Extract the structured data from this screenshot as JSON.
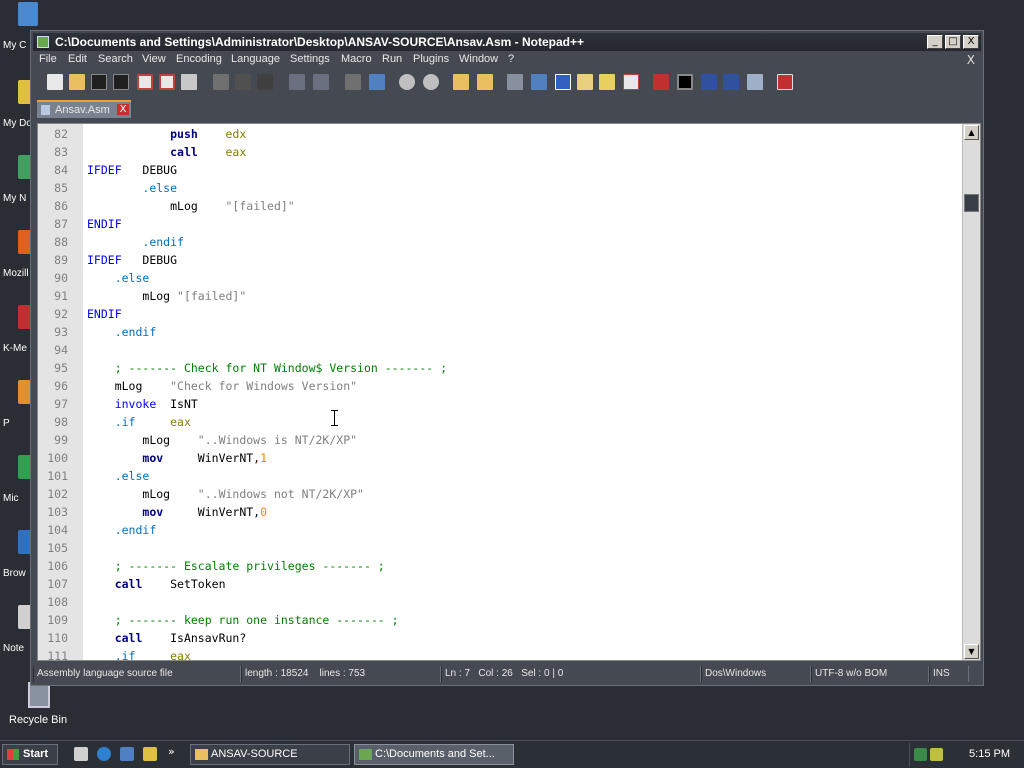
{
  "desktop": {
    "icons": [
      {
        "label": "My C",
        "color": "#4a8ad0"
      },
      {
        "label": "My Do",
        "color": "#e0c040"
      },
      {
        "label": "My N",
        "color": "#40a060"
      },
      {
        "label": "Mozill",
        "color": "#e06020"
      },
      {
        "label": "K-Me",
        "color": "#c03030"
      },
      {
        "label": "P",
        "color": "#e09030"
      },
      {
        "label": "Mic",
        "color": "#30a050"
      },
      {
        "label": "Brow",
        "color": "#3070c0"
      },
      {
        "label": "Note",
        "color": "#d0d0d0"
      }
    ],
    "recycle_bin": "Recycle Bin"
  },
  "window": {
    "title": "C:\\Documents and Settings\\Administrator\\Desktop\\ANSAV-SOURCE\\Ansav.Asm - Notepad++",
    "buttons": {
      "minimize": "_",
      "maximize": "□",
      "close": "X"
    },
    "menu": [
      "File",
      "Edit",
      "Search",
      "View",
      "Encoding",
      "Language",
      "Settings",
      "Macro",
      "Run",
      "Plugins",
      "Window",
      "?"
    ],
    "menu_close": "X",
    "toolbar_icons": [
      "new-file",
      "open-file",
      "save",
      "save-all",
      "close",
      "close-all",
      "print",
      "cut",
      "copy",
      "paste",
      "undo",
      "redo",
      "find",
      "replace",
      "zoom-in",
      "zoom-out",
      "sync-v",
      "sync-h",
      "wrap",
      "all-chars",
      "indent-guide",
      "user-lang",
      "doc-map",
      "function-list",
      "record-macro",
      "stop-record",
      "play-macro",
      "run-macro-multiple",
      "save-macro",
      "spellcheck"
    ],
    "tab": {
      "label": "Ansav.Asm",
      "close": "X"
    }
  },
  "editor": {
    "lines": [
      {
        "n": "82",
        "tokens": [
          [
            "",
            "            "
          ],
          [
            "kw-bold",
            "push"
          ],
          [
            "",
            "    "
          ],
          [
            "reg",
            "edx"
          ]
        ]
      },
      {
        "n": "83",
        "tokens": [
          [
            "",
            "            "
          ],
          [
            "kw-bold",
            "call"
          ],
          [
            "",
            "    "
          ],
          [
            "reg",
            "eax"
          ]
        ]
      },
      {
        "n": "84",
        "tokens": [
          [
            "kw",
            "IFDEF"
          ],
          [
            "",
            "   "
          ],
          [
            "plain",
            "DEBUG"
          ]
        ]
      },
      {
        "n": "85",
        "tokens": [
          [
            "",
            "        "
          ],
          [
            "dir",
            ".else"
          ]
        ]
      },
      {
        "n": "86",
        "tokens": [
          [
            "",
            "            "
          ],
          [
            "plain",
            "mLog"
          ],
          [
            "",
            "    "
          ],
          [
            "str",
            "\"[failed]\""
          ]
        ]
      },
      {
        "n": "87",
        "tokens": [
          [
            "kw",
            "ENDIF"
          ]
        ]
      },
      {
        "n": "88",
        "tokens": [
          [
            "",
            "        "
          ],
          [
            "dir",
            ".endif"
          ]
        ]
      },
      {
        "n": "89",
        "tokens": [
          [
            "kw",
            "IFDEF"
          ],
          [
            "",
            "   "
          ],
          [
            "plain",
            "DEBUG"
          ]
        ]
      },
      {
        "n": "90",
        "tokens": [
          [
            "",
            "    "
          ],
          [
            "dir",
            ".else"
          ]
        ]
      },
      {
        "n": "91",
        "tokens": [
          [
            "",
            "        "
          ],
          [
            "plain",
            "mLog "
          ],
          [
            "str",
            "\"[failed]\""
          ]
        ]
      },
      {
        "n": "92",
        "tokens": [
          [
            "kw",
            "ENDIF"
          ]
        ]
      },
      {
        "n": "93",
        "tokens": [
          [
            "",
            "    "
          ],
          [
            "dir",
            ".endif"
          ]
        ]
      },
      {
        "n": "94",
        "tokens": []
      },
      {
        "n": "95",
        "tokens": [
          [
            "",
            "    "
          ],
          [
            "cmt",
            "; ------- Check for NT Window$ Version ------- ;"
          ]
        ]
      },
      {
        "n": "96",
        "tokens": [
          [
            "",
            "    "
          ],
          [
            "plain",
            "mLog"
          ],
          [
            "",
            "    "
          ],
          [
            "str",
            "\"Check for Windows Version\""
          ]
        ]
      },
      {
        "n": "97",
        "tokens": [
          [
            "",
            "    "
          ],
          [
            "kw",
            "invoke"
          ],
          [
            "",
            "  "
          ],
          [
            "plain",
            "IsNT"
          ]
        ]
      },
      {
        "n": "98",
        "tokens": [
          [
            "",
            "    "
          ],
          [
            "dir",
            ".if"
          ],
          [
            "",
            "     "
          ],
          [
            "reg",
            "eax"
          ]
        ]
      },
      {
        "n": "99",
        "tokens": [
          [
            "",
            "        "
          ],
          [
            "plain",
            "mLog"
          ],
          [
            "",
            "    "
          ],
          [
            "str",
            "\"..Windows is NT/2K/XP\""
          ]
        ]
      },
      {
        "n": "100",
        "tokens": [
          [
            "",
            "        "
          ],
          [
            "kw-bold",
            "mov"
          ],
          [
            "",
            "     "
          ],
          [
            "plain",
            "WinVerNT,"
          ],
          [
            "num",
            "1"
          ]
        ]
      },
      {
        "n": "101",
        "tokens": [
          [
            "",
            "    "
          ],
          [
            "dir",
            ".else"
          ]
        ]
      },
      {
        "n": "102",
        "tokens": [
          [
            "",
            "        "
          ],
          [
            "plain",
            "mLog"
          ],
          [
            "",
            "    "
          ],
          [
            "str",
            "\"..Windows not NT/2K/XP\""
          ]
        ]
      },
      {
        "n": "103",
        "tokens": [
          [
            "",
            "        "
          ],
          [
            "kw-bold",
            "mov"
          ],
          [
            "",
            "     "
          ],
          [
            "plain",
            "WinVerNT,"
          ],
          [
            "num",
            "0"
          ]
        ]
      },
      {
        "n": "104",
        "tokens": [
          [
            "",
            "    "
          ],
          [
            "dir",
            ".endif"
          ]
        ]
      },
      {
        "n": "105",
        "tokens": []
      },
      {
        "n": "106",
        "tokens": [
          [
            "",
            "    "
          ],
          [
            "cmt",
            "; ------- Escalate privileges ------- ;"
          ]
        ]
      },
      {
        "n": "107",
        "tokens": [
          [
            "",
            "    "
          ],
          [
            "kw-bold",
            "call"
          ],
          [
            "",
            "    "
          ],
          [
            "plain",
            "SetToken"
          ]
        ]
      },
      {
        "n": "108",
        "tokens": []
      },
      {
        "n": "109",
        "tokens": [
          [
            "",
            "    "
          ],
          [
            "cmt",
            "; ------- keep run one instance ------- ;"
          ]
        ]
      },
      {
        "n": "110",
        "tokens": [
          [
            "",
            "    "
          ],
          [
            "kw-bold",
            "call"
          ],
          [
            "",
            "    "
          ],
          [
            "plain",
            "IsAnsavRun?"
          ]
        ]
      },
      {
        "n": "111",
        "tokens": [
          [
            "",
            "    "
          ],
          [
            "dir",
            ".if"
          ],
          [
            "",
            "     "
          ],
          [
            "reg",
            "eax"
          ]
        ]
      }
    ],
    "scroll_up": "▲",
    "scroll_down": "▼"
  },
  "statusbar": {
    "filetype": "Assembly language source file",
    "length": "length : 18524",
    "lines": "lines : 753",
    "ln": "Ln : 7",
    "col": "Col : 26",
    "sel": "Sel : 0 | 0",
    "eol": "Dos\\Windows",
    "encoding": "UTF-8 w/o BOM",
    "mode": "INS"
  },
  "taskbar": {
    "start": "Start",
    "quicklaunch_more": "»",
    "tasks": [
      {
        "label": "ANSAV-SOURCE",
        "active": false
      },
      {
        "label": "C:\\Documents and Set...",
        "active": true
      }
    ],
    "clock": "5:15 PM"
  },
  "colors": {
    "keyword_bold": "#00007f",
    "keyword": "#0000ff",
    "directive": "#0070c0",
    "register": "#808000",
    "string": "#808080",
    "comment": "#008000",
    "number": "#ff8000"
  }
}
